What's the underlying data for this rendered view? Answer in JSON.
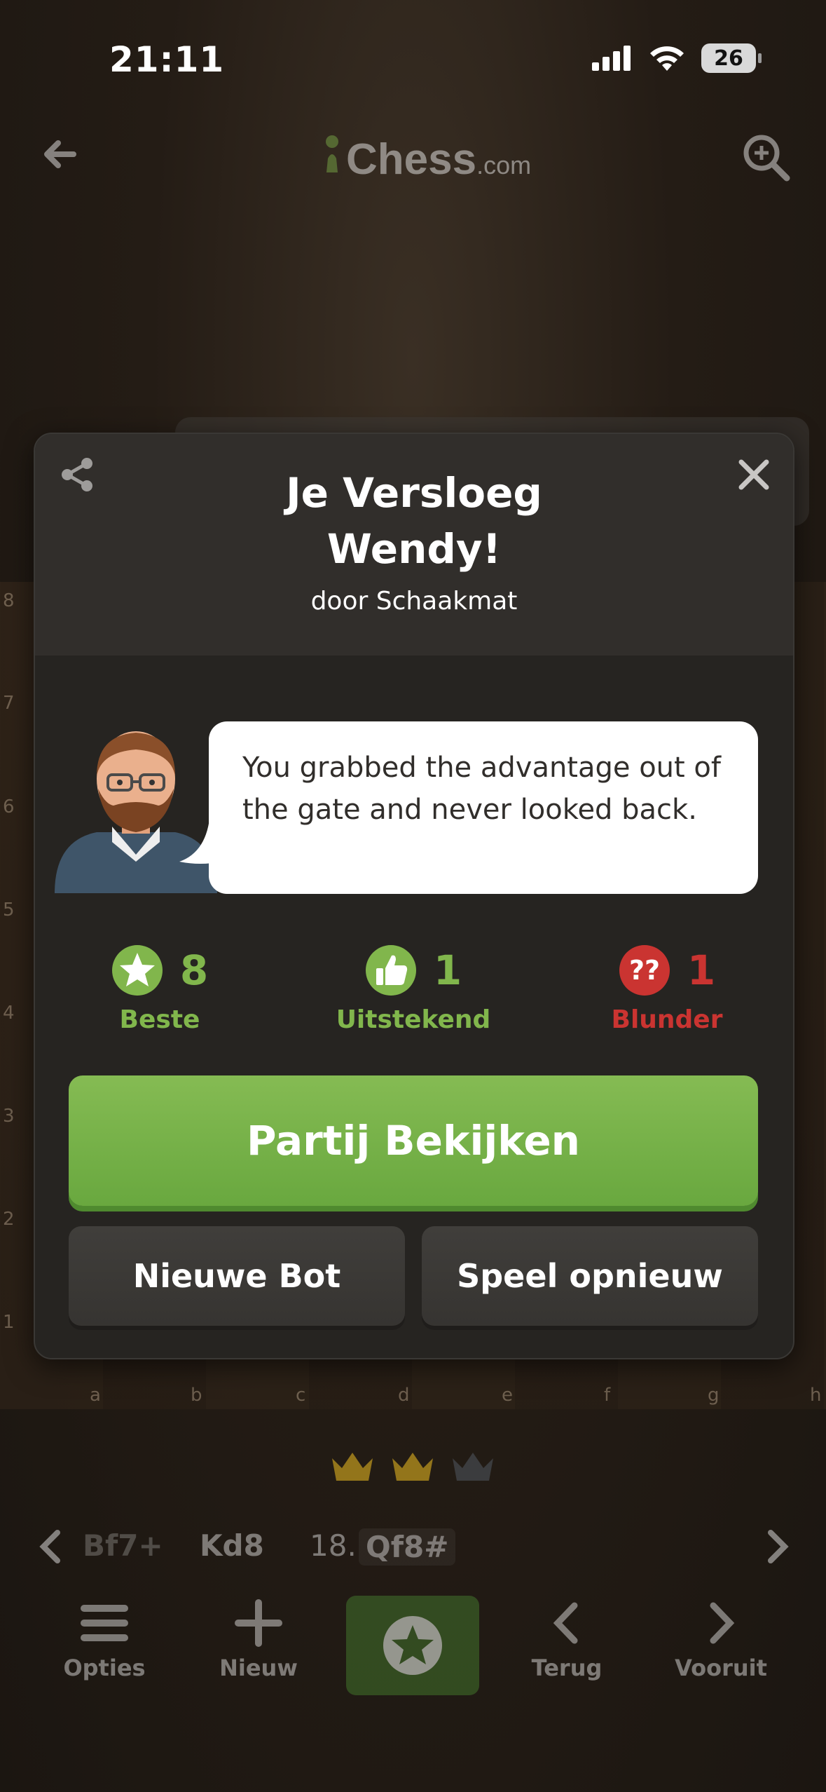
{
  "status_bar": {
    "time": "21:11",
    "battery": "26"
  },
  "header": {
    "logo_main": "Chess",
    "logo_sub": ".com"
  },
  "board": {
    "ranks": [
      "8",
      "7",
      "6",
      "5",
      "4",
      "3",
      "2",
      "1"
    ],
    "files": [
      "a",
      "b",
      "c",
      "d",
      "e",
      "f",
      "g",
      "h"
    ]
  },
  "modal": {
    "title_line1": "Je Versloeg",
    "title_line2": "Wendy!",
    "subtitle": "door Schaakmat",
    "coach_message": "You grabbed the advantage out of the gate and never looked back.",
    "stats": [
      {
        "count": "8",
        "label": "Beste",
        "icon": "star-icon",
        "color": "#81b64c"
      },
      {
        "count": "1",
        "label": "Uitstekend",
        "icon": "thumbs-up-icon",
        "color": "#81b64c"
      },
      {
        "count": "1",
        "label": "Blunder",
        "icon": "double-question-icon",
        "color": "#ca3431"
      }
    ],
    "primary_button": "Partij Bekijken",
    "secondary_buttons": [
      "Nieuwe Bot",
      "Speel opnieuw"
    ]
  },
  "moves": {
    "prev_move": "Bf7+",
    "reply": "Kd8",
    "move_number": "18.",
    "current_move": "Qf8#"
  },
  "bottom_nav": [
    {
      "label": "Opties",
      "icon": "hamburger-icon"
    },
    {
      "label": "Nieuw",
      "icon": "plus-icon"
    },
    {
      "label": "",
      "icon": "star-icon"
    },
    {
      "label": "Terug",
      "icon": "chevron-left-icon"
    },
    {
      "label": "Vooruit",
      "icon": "chevron-right-icon"
    }
  ],
  "colors": {
    "accent_green": "#81b64c",
    "blunder_red": "#ca3431",
    "modal_bg": "#262421"
  }
}
